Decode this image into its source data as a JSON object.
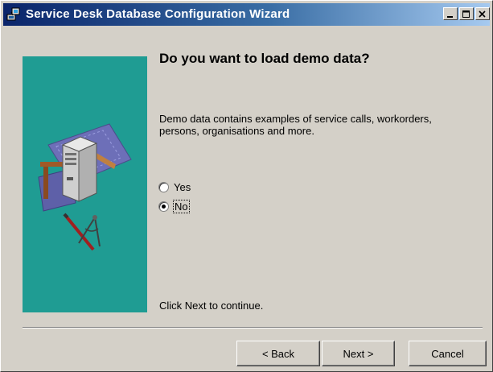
{
  "window": {
    "title": "Service Desk Database Configuration Wizard"
  },
  "wizard": {
    "heading": "Do you want to load demo data?",
    "description": "Demo data contains examples of service calls, workorders, persons, organisations and more.",
    "options": [
      {
        "label": "Yes",
        "selected": false
      },
      {
        "label": "No",
        "selected": true
      }
    ],
    "footer_note": "Click Next to continue."
  },
  "buttons": {
    "back": "< Back",
    "next": "Next >",
    "cancel": "Cancel"
  },
  "colors": {
    "titlebar_start": "#0a246a",
    "titlebar_end": "#a6caf0",
    "side_panel": "#1f9c93",
    "dialog_face": "#d4d0c8"
  },
  "icons": [
    "app-icon",
    "minimize-icon",
    "maximize-icon",
    "close-icon",
    "server-icon",
    "blueprint-icon",
    "drafting-tools-icon"
  ]
}
